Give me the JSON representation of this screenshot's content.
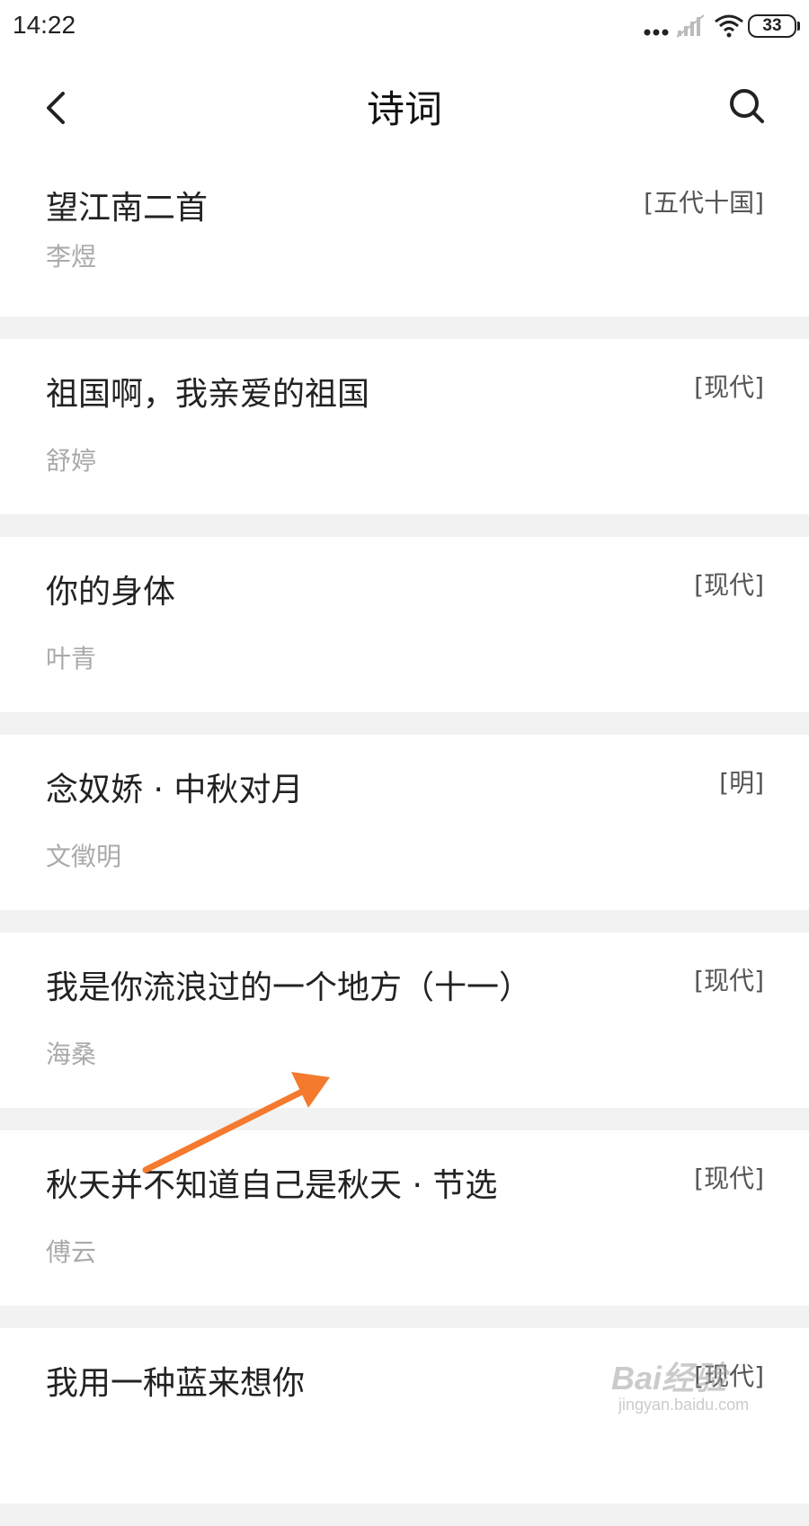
{
  "status": {
    "time": "14:22",
    "battery": "33"
  },
  "header": {
    "title": "诗词"
  },
  "poems": [
    {
      "title": "望江南二首",
      "author": "李煜",
      "dynasty": "[五代十国]"
    },
    {
      "title": "祖国啊，我亲爱的祖国",
      "author": "舒婷",
      "dynasty": "[现代]"
    },
    {
      "title": "你的身体",
      "author": "叶青",
      "dynasty": "[现代]"
    },
    {
      "title": "念奴娇 · 中秋对月",
      "author": "文徵明",
      "dynasty": "[明]"
    },
    {
      "title": "我是你流浪过的一个地方（十一）",
      "author": "海桑",
      "dynasty": "[现代]"
    },
    {
      "title": "秋天并不知道自己是秋天 · 节选",
      "author": "傅云",
      "dynasty": "[现代]"
    },
    {
      "title": "我用一种蓝来想你",
      "author": "",
      "dynasty": "[现代]"
    }
  ],
  "annotation": {
    "arrow_color": "#f47a2e"
  },
  "watermark": {
    "main": "Bai经验",
    "sub": "jingyan.baidu.com"
  },
  "icons": [
    "back-arrow-icon",
    "search-icon",
    "signal-dots-icon",
    "cell-signal-icon",
    "wifi-icon",
    "battery-icon"
  ]
}
